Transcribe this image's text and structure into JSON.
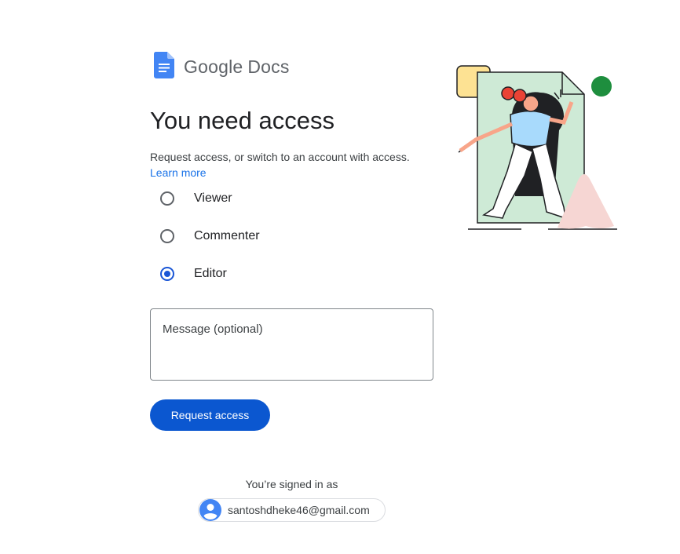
{
  "logo": {
    "google": "Google",
    "product": "Docs"
  },
  "page_title": "You need access",
  "description": "Request access, or switch to an account with access.",
  "learn_more": "Learn more",
  "roles": [
    {
      "label": "Viewer",
      "selected": false
    },
    {
      "label": "Commenter",
      "selected": false
    },
    {
      "label": "Editor",
      "selected": true
    }
  ],
  "message": {
    "placeholder": "Message (optional)",
    "value": ""
  },
  "request_button": "Request access",
  "signed_in_label": "You’re signed in as",
  "account_email": "santoshdheke46@gmail.com",
  "colors": {
    "accent": "#0b57d0",
    "radio_selected": "#1a56d6",
    "link": "#1a73e8",
    "docs_blue": "#4285f4"
  },
  "icons": {
    "logo": "google-docs-icon",
    "account": "account-circle-icon",
    "illustration": "person-entering-document-illustration"
  }
}
